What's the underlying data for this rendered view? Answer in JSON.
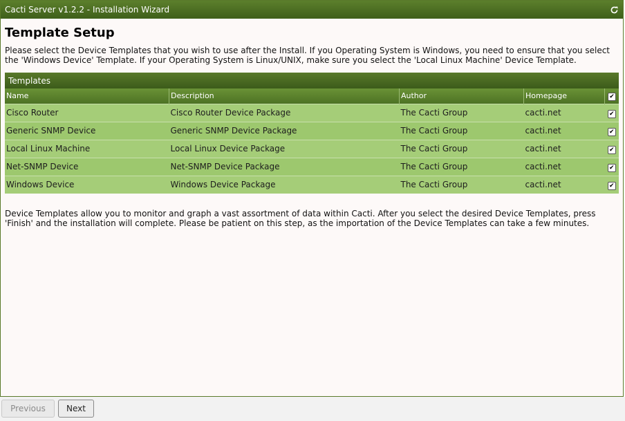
{
  "window": {
    "title": "Cacti Server v1.2.2 - Installation Wizard"
  },
  "page": {
    "heading": "Template Setup",
    "intro": "Please select the Device Templates that you wish to use after the Install. If you Operating System is Windows, you need to ensure that you select the 'Windows Device' Template. If your Operating System is Linux/UNIX, make sure you select the 'Local Linux Machine' Device Template.",
    "outro": "Device Templates allow you to monitor and graph a vast assortment of data within Cacti. After you select the desired Device Templates, press 'Finish' and the installation will complete. Please be patient on this step, as the importation of the Device Templates can take a few minutes."
  },
  "templates": {
    "panel_title": "Templates",
    "columns": [
      "Name",
      "Description",
      "Author",
      "Homepage"
    ],
    "select_all_checked": true,
    "rows": [
      {
        "name": "Cisco Router",
        "description": "Cisco Router Device Package",
        "author": "The Cacti Group",
        "homepage": "cacti.net",
        "checked": true
      },
      {
        "name": "Generic SNMP Device",
        "description": "Generic SNMP Device Package",
        "author": "The Cacti Group",
        "homepage": "cacti.net",
        "checked": true
      },
      {
        "name": "Local Linux Machine",
        "description": "Local Linux Device Package",
        "author": "The Cacti Group",
        "homepage": "cacti.net",
        "checked": true
      },
      {
        "name": "Net-SNMP Device",
        "description": "Net-SNMP Device Package",
        "author": "The Cacti Group",
        "homepage": "cacti.net",
        "checked": true
      },
      {
        "name": "Windows Device",
        "description": "Windows Device Package",
        "author": "The Cacti Group",
        "homepage": "cacti.net",
        "checked": true
      }
    ]
  },
  "footer": {
    "previous_label": "Previous",
    "next_label": "Next"
  },
  "icons": {
    "refresh": "refresh-icon",
    "checkbox": "checkbox-icon"
  },
  "colors": {
    "header_green": "#4a6c22",
    "row_green": "#a5cd78"
  }
}
